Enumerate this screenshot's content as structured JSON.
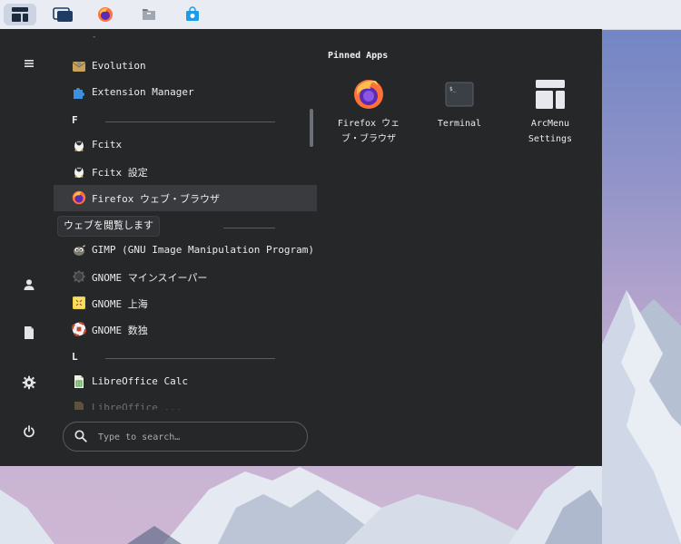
{
  "panel": {
    "buttons": [
      {
        "name": "arcmenu",
        "icon": "layout-icon",
        "active": true
      },
      {
        "name": "windows",
        "icon": "windows-icon"
      },
      {
        "name": "firefox",
        "icon": "firefox-icon"
      },
      {
        "name": "files",
        "icon": "files-icon"
      },
      {
        "name": "store",
        "icon": "store-icon"
      }
    ]
  },
  "rail": {
    "menu_icon": "hamburger-icon",
    "user_icon": "user-icon",
    "documents_icon": "document-icon",
    "settings_icon": "gear-icon",
    "power_icon": "power-icon"
  },
  "apps": {
    "top_partial": "-",
    "evolution": "Evolution",
    "extension_manager": "Extension Manager",
    "section_f": "F",
    "fcitx": "Fcitx",
    "fcitx_settings": "Fcitx 設定",
    "firefox": "Firefox ウェブ・ブラウザ",
    "tooltip": "ウェブを閲覧します",
    "gimp": "GIMP (GNU Image Manipulation Program)",
    "mines": "GNOME マインスイーパー",
    "mahjongg": "GNOME 上海",
    "sudoku": "GNOME 数独",
    "section_l": "L",
    "libreoffice_calc": "LibreOffice Calc",
    "libreoffice_partial": "LibreOffice ..."
  },
  "search": {
    "placeholder": "Type to search…"
  },
  "pinned": {
    "title": "Pinned Apps",
    "items": [
      {
        "label": "Firefox ウェ\nブ・ブラウザ",
        "icon": "firefox-icon"
      },
      {
        "label": "Terminal",
        "icon": "terminal-icon"
      },
      {
        "label": "ArcMenu\nSettings",
        "icon": "layout-icon"
      }
    ]
  },
  "colors": {
    "menu_bg": "#262729",
    "hover_bg": "#3a3b3e",
    "panel_bg": "#e9ecf3",
    "accent": "#1e9be6"
  }
}
